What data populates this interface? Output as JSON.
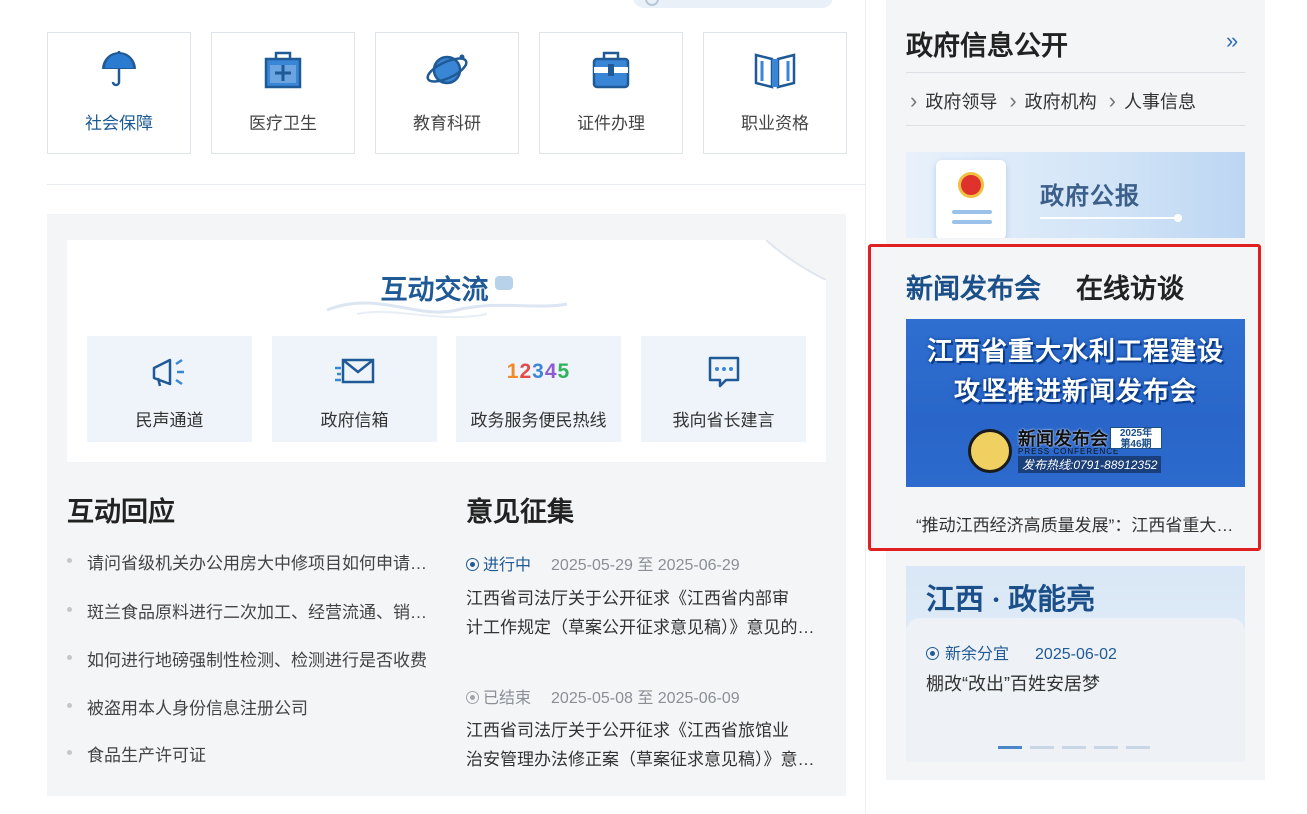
{
  "services": [
    {
      "label": "社会保障",
      "icon": "umbrella-icon"
    },
    {
      "label": "医疗卫生",
      "icon": "medical-kit-icon"
    },
    {
      "label": "教育科研",
      "icon": "planet-icon"
    },
    {
      "label": "证件办理",
      "icon": "briefcase-icon"
    },
    {
      "label": "职业资格",
      "icon": "book-icon"
    }
  ],
  "interaction": {
    "title": "互动交流",
    "buttons": [
      {
        "label": "民声通道",
        "icon": "megaphone-icon"
      },
      {
        "label": "政府信箱",
        "icon": "mail-icon"
      },
      {
        "label": "政务服务便民热线",
        "icon_text": "12345"
      },
      {
        "label": "我向省长建言",
        "icon": "chat-icon"
      }
    ],
    "hotline_colors": [
      "#f08a24",
      "#e34b4b",
      "#3f86d9",
      "#8e5bd1",
      "#2fb45a"
    ]
  },
  "responses": {
    "title": "互动回应",
    "items": [
      "请问省级机关办公用房大中修项目如何申请审批？",
      "斑兰食品原料进行二次加工、经营流通、销售是否合规",
      "如何进行地磅强制性检测、检测进行是否收费",
      "被盗用本人身份信息注册公司",
      "食品生产许可证"
    ]
  },
  "opinions": {
    "title": "意见征集",
    "items": [
      {
        "status": "进行中",
        "done": false,
        "start": "2025-05-29",
        "sep": "至",
        "end": "2025-06-29",
        "line1": "江西省司法厅关于公开征求《江西省内部审",
        "line2": "计工作规定（草案公开征求意见稿）》意见的公告"
      },
      {
        "status": "已结束",
        "done": true,
        "start": "2025-05-08",
        "sep": "至",
        "end": "2025-06-09",
        "line1": "江西省司法厅关于公开征求《江西省旅馆业",
        "line2": "治安管理办法修正案（草案征求意见稿）》意见的公告"
      }
    ]
  },
  "gov_info": {
    "title": "政府信息公开",
    "more": "»",
    "links": [
      "政府领导",
      "政府机构",
      "人事信息"
    ]
  },
  "gazette": {
    "label": "政府公报"
  },
  "news": {
    "tabs": [
      "新闻发布会",
      "在线访谈"
    ],
    "banner_line1": "江西省重大水利工程建设",
    "banner_line2": "攻坚推进新闻发布会",
    "conf_cn": "新闻发布会",
    "conf_en": "PRESS CONFERENCE",
    "year": "2025年",
    "issue": "第46期",
    "tel": "发布热线:0791-88912352",
    "caption": "“推动江西经济高质量发展”：江西省重大水利工程建设攻坚推进新闻发布会"
  },
  "jiangxi": {
    "title": "江西 · 政能亮",
    "tag": "新余分宜",
    "date": "2025-06-02",
    "text": "棚改“改出”百姓安居梦"
  },
  "colors": {
    "accent": "#1f5a96",
    "highlight_border": "#e02020"
  }
}
